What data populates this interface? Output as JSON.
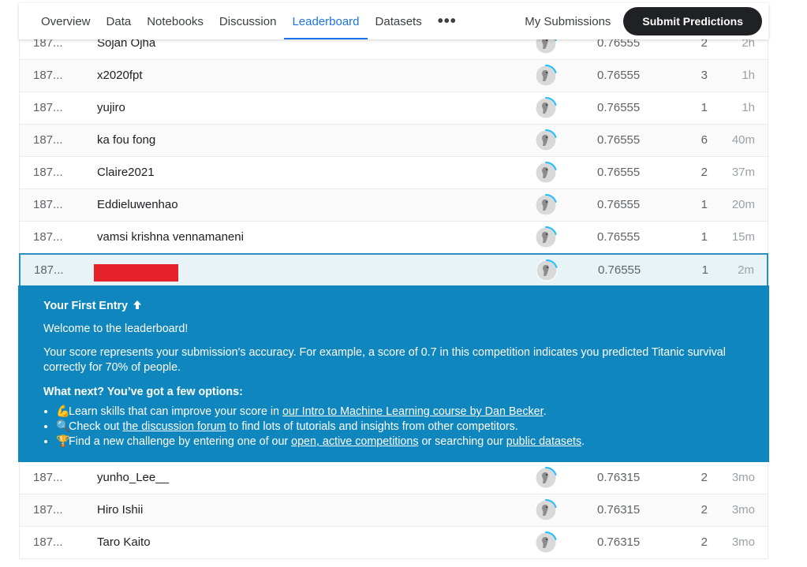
{
  "nav": {
    "tabs": [
      {
        "label": "Overview",
        "active": false
      },
      {
        "label": "Data",
        "active": false
      },
      {
        "label": "Notebooks",
        "active": false
      },
      {
        "label": "Discussion",
        "active": false
      },
      {
        "label": "Leaderboard",
        "active": true
      },
      {
        "label": "Datasets",
        "active": false
      }
    ],
    "more_label": "•••",
    "my_submissions": "My Submissions",
    "submit_button": "Submit Predictions"
  },
  "leaderboard": {
    "rows_top": [
      {
        "rank": "187...",
        "name": "Sojan Ojha",
        "score": "0.76555",
        "entries": "2",
        "last": "2h"
      },
      {
        "rank": "187...",
        "name": "x2020fpt",
        "score": "0.76555",
        "entries": "3",
        "last": "1h"
      },
      {
        "rank": "187...",
        "name": "yujiro",
        "score": "0.76555",
        "entries": "1",
        "last": "1h"
      },
      {
        "rank": "187...",
        "name": "ka fou fong",
        "score": "0.76555",
        "entries": "6",
        "last": "40m"
      },
      {
        "rank": "187...",
        "name": "Claire2021",
        "score": "0.76555",
        "entries": "2",
        "last": "37m"
      },
      {
        "rank": "187...",
        "name": "Eddieluwenhao",
        "score": "0.76555",
        "entries": "1",
        "last": "20m"
      },
      {
        "rank": "187...",
        "name": "vamsi krishna vennamaneni",
        "score": "0.76555",
        "entries": "1",
        "last": "15m"
      }
    ],
    "my_row": {
      "rank": "187...",
      "score": "0.76555",
      "entries": "1",
      "last": "2m"
    },
    "rows_bottom": [
      {
        "rank": "187...",
        "name": "yunho_Lee__",
        "score": "0.76315",
        "entries": "2",
        "last": "3mo"
      },
      {
        "rank": "187...",
        "name": "Hiro Ishii",
        "score": "0.76315",
        "entries": "2",
        "last": "3mo"
      },
      {
        "rank": "187...",
        "name": "Taro Kaito",
        "score": "0.76315",
        "entries": "2",
        "last": "3mo"
      }
    ]
  },
  "banner": {
    "title": "Your First Entry",
    "title_icon": "arrow-up-icon",
    "welcome": "Welcome to the leaderboard!",
    "body": "Your score represents your submission's accuracy. For example, a score of 0.7 in this competition indicates you predicted Titanic survival correctly for 70% of people.",
    "next": "What next? You’ve got a few options:",
    "options": [
      {
        "emoji": "💪",
        "pre": "Learn skills that can improve your score in ",
        "link": "our Intro to Machine Learning course by Dan Becker",
        "post": "."
      },
      {
        "emoji": "🔍",
        "pre": "Check out ",
        "link": "the discussion forum",
        "post": " to find lots of tutorials and insights from other competitors."
      },
      {
        "emoji": "🏆",
        "pre": "Find a new challenge by entering one of our ",
        "link": "open, active competitions",
        "post": " or searching our ",
        "link2": "public datasets",
        "post2": "."
      }
    ]
  },
  "colors": {
    "accent": "#1a73e8",
    "banner": "#0f86bd",
    "highlight_border": "#2c8fbf",
    "redaction": "#e5222a"
  }
}
